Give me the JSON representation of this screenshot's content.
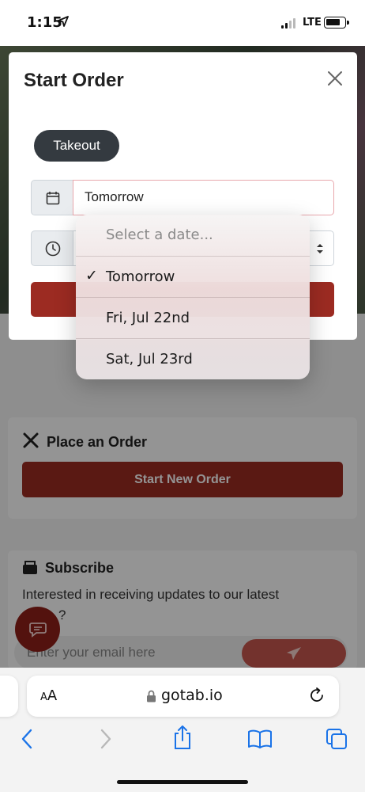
{
  "status_bar": {
    "time": "1:15",
    "network": "LTE"
  },
  "modal": {
    "title": "Start Order",
    "order_type": "Takeout",
    "date_value": "Tomorrow"
  },
  "date_picker": {
    "placeholder": "Select a date...",
    "options": [
      {
        "label": "Tomorrow",
        "selected": true
      },
      {
        "label": "Fri, Jul 22nd",
        "selected": false
      },
      {
        "label": "Sat, Jul 23rd",
        "selected": false
      }
    ]
  },
  "page": {
    "place_order_title": "Place an Order",
    "start_new_order_label": "Start New Order",
    "subscribe_title": "Subscribe",
    "subscribe_text_line1": "Interested in receiving updates to our latest",
    "subscribe_text_line2": "?",
    "email_placeholder": "Enter your email here"
  },
  "browser": {
    "text_size_label": "AA",
    "domain": "gotab.io"
  },
  "colors": {
    "brand": "#9c2b22",
    "pill": "#343a40",
    "link": "#1a73e8"
  }
}
